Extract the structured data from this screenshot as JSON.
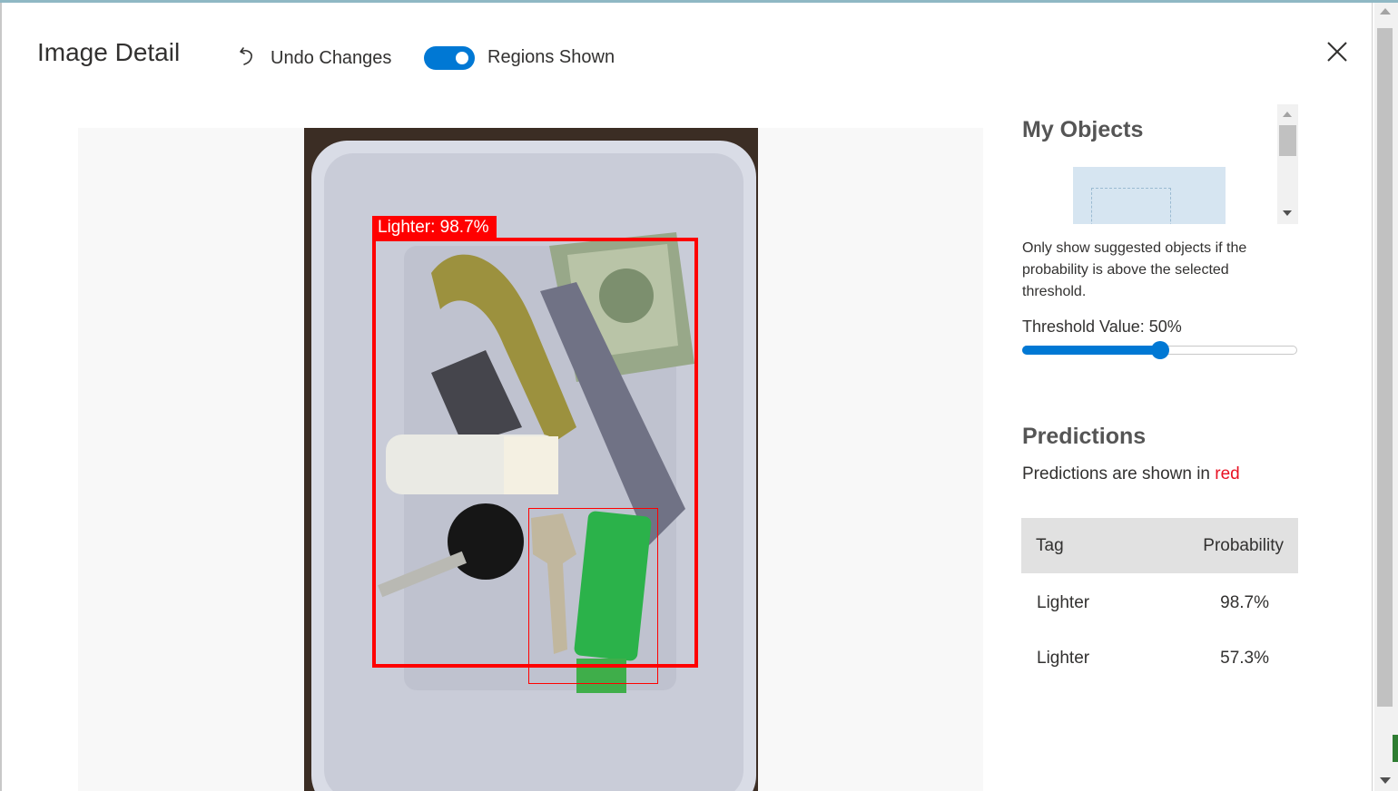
{
  "header": {
    "title": "Image Detail",
    "undo_label": "Undo Changes",
    "toggle_label": "Regions Shown",
    "toggle_on": true
  },
  "regions": {
    "primary_label": "Lighter: 98.7%"
  },
  "sidebar": {
    "objects_title": "My Objects",
    "threshold_hint": "Only show suggested objects if the probability is above the selected threshold.",
    "threshold_label": "Threshold Value: 50%",
    "threshold_value": 0.5,
    "predictions_title": "Predictions",
    "predictions_sub_prefix": "Predictions are shown in ",
    "predictions_sub_color_word": "red",
    "table": {
      "headers": [
        "Tag",
        "Probability"
      ],
      "rows": [
        {
          "tag": "Lighter",
          "probability": "98.7%"
        },
        {
          "tag": "Lighter",
          "probability": "57.3%"
        }
      ]
    }
  },
  "colors": {
    "accent": "#0078d4",
    "region": "#ff0000",
    "prediction_word": "#e81123"
  },
  "icons": {
    "undo": "undo-icon",
    "close": "close-icon"
  }
}
